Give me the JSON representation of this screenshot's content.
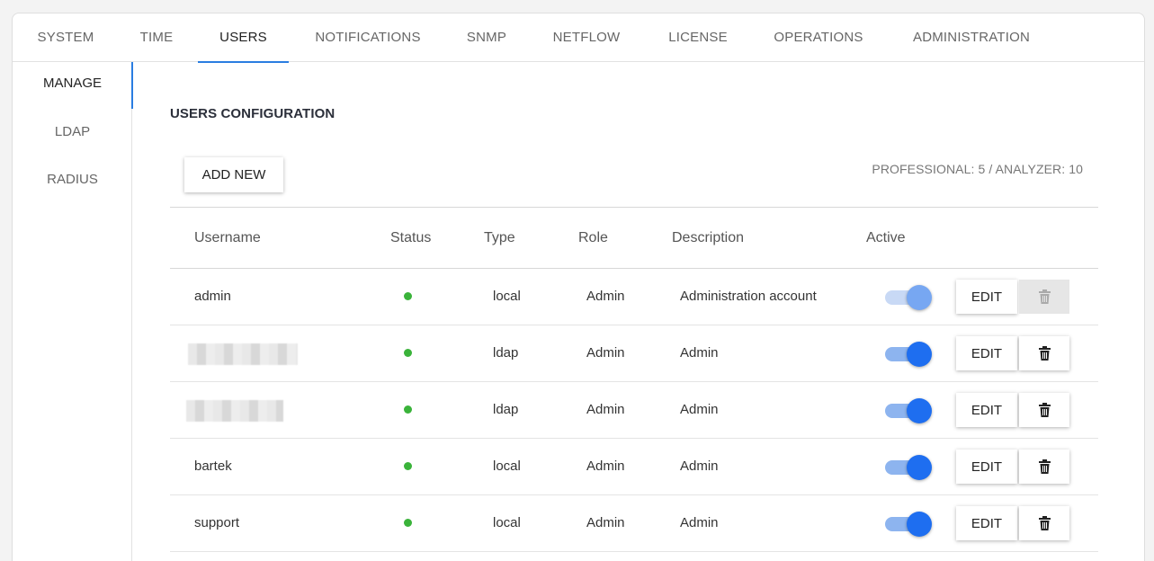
{
  "tabs": [
    {
      "label": "SYSTEM",
      "active": false
    },
    {
      "label": "TIME",
      "active": false
    },
    {
      "label": "USERS",
      "active": true
    },
    {
      "label": "NOTIFICATIONS",
      "active": false
    },
    {
      "label": "SNMP",
      "active": false
    },
    {
      "label": "NETFLOW",
      "active": false
    },
    {
      "label": "LICENSE",
      "active": false
    },
    {
      "label": "OPERATIONS",
      "active": false
    },
    {
      "label": "ADMINISTRATION",
      "active": false
    }
  ],
  "sidebar": {
    "items": [
      {
        "label": "MANAGE",
        "active": true
      },
      {
        "label": "LDAP",
        "active": false
      },
      {
        "label": "RADIUS",
        "active": false
      }
    ]
  },
  "main": {
    "title": "USERS CONFIGURATION",
    "add_label": "ADD NEW",
    "license_info": "PROFESSIONAL: 5 / ANALYZER: 10"
  },
  "table": {
    "columns": [
      "Username",
      "Status",
      "Type",
      "Role",
      "Description",
      "Active"
    ],
    "edit_label": "EDIT",
    "rows": [
      {
        "username": "admin",
        "type": "local",
        "role": "Admin",
        "description": "Administration account",
        "active": true,
        "locked": true
      },
      {
        "username": "",
        "type": "ldap",
        "role": "Admin",
        "description": "Admin",
        "active": true,
        "locked": false
      },
      {
        "username": "",
        "type": "ldap",
        "role": "Admin",
        "description": "Admin",
        "active": true,
        "locked": false
      },
      {
        "username": "bartek",
        "type": "local",
        "role": "Admin",
        "description": "Admin",
        "active": true,
        "locked": false
      },
      {
        "username": "support",
        "type": "local",
        "role": "Admin",
        "description": "Admin",
        "active": true,
        "locked": false
      }
    ]
  },
  "colors": {
    "accent": "#2a7de1",
    "status_ok": "#3ab33a",
    "toggle_on": "#1e6ef0"
  }
}
